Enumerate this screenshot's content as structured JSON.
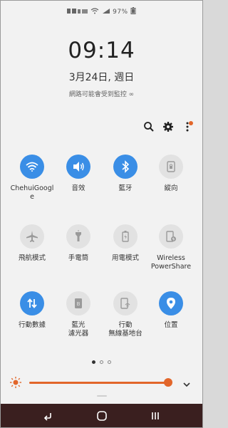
{
  "status_bar": {
    "text": "97%"
  },
  "clock": {
    "time": "09:14",
    "date": "3月24日, 週日",
    "network": "網路可能會受到監控 ∞"
  },
  "toolbar": {
    "icons": [
      "search-icon",
      "gear-icon",
      "more-vert-icon"
    ]
  },
  "tiles": [
    {
      "label": "ChehuiGoogle",
      "icon": "wifi-icon",
      "state": "on"
    },
    {
      "label": "音效",
      "icon": "volume-icon",
      "state": "on"
    },
    {
      "label": "藍牙",
      "icon": "bluetooth-icon",
      "state": "on"
    },
    {
      "label": "縱向",
      "icon": "rotation-lock-icon",
      "state": "off"
    },
    {
      "label": "飛航模式",
      "icon": "airplane-icon",
      "state": "off"
    },
    {
      "label": "手電筒",
      "icon": "flashlight-icon",
      "state": "off"
    },
    {
      "label": "用電模式",
      "icon": "battery-mode-icon",
      "state": "off"
    },
    {
      "label": "Wireless\nPowerShare",
      "icon": "wireless-powershare-icon",
      "state": "off"
    },
    {
      "label": "行動數據",
      "icon": "mobile-data-icon",
      "state": "on"
    },
    {
      "label": "藍光\n濾光器",
      "icon": "blue-light-filter-icon",
      "state": "off"
    },
    {
      "label": "行動\n無線基地台",
      "icon": "mobile-hotspot-icon",
      "state": "off"
    },
    {
      "label": "位置",
      "icon": "location-icon",
      "state": "on"
    }
  ],
  "page_indicator": {
    "count": 3,
    "active": 0
  },
  "brightness": {
    "level_percent": 95
  },
  "colors": {
    "accent": "#3a8ee6",
    "brightness": "#e2662a",
    "navbar": "#3a1f1f"
  }
}
